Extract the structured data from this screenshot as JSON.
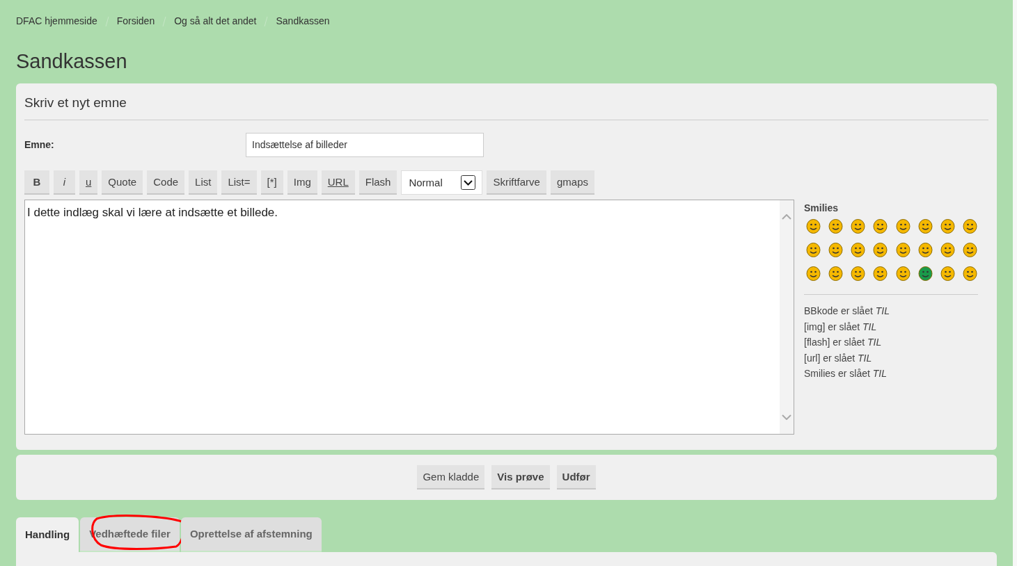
{
  "breadcrumbs": [
    "DFAC hjemmeside",
    "Forsiden",
    "Og så alt det andet",
    "Sandkassen"
  ],
  "page_title": "Sandkassen",
  "form": {
    "heading": "Skriv et nyt emne",
    "subject_label": "Emne:",
    "subject_value": "Indsættelse af billeder",
    "toolbar": [
      {
        "label": "B",
        "kind": "bold"
      },
      {
        "label": "i",
        "kind": "italic"
      },
      {
        "label": "u",
        "kind": "underline"
      },
      {
        "label": "Quote",
        "kind": "plain"
      },
      {
        "label": "Code",
        "kind": "plain"
      },
      {
        "label": "List",
        "kind": "plain"
      },
      {
        "label": "List=",
        "kind": "plain"
      },
      {
        "label": "[*]",
        "kind": "plain"
      },
      {
        "label": "Img",
        "kind": "plain"
      },
      {
        "label": "URL",
        "kind": "underline"
      },
      {
        "label": "Flash",
        "kind": "plain"
      },
      {
        "label": "Normal",
        "kind": "select"
      },
      {
        "label": "Skriftfarve",
        "kind": "plain"
      },
      {
        "label": "gmaps",
        "kind": "plain"
      }
    ],
    "message": "I dette indlæg skal vi lære at indsætte et billede.",
    "smilies_heading": "Smilies",
    "smilies": [
      {
        "color": "#f5b800"
      },
      {
        "color": "#f5b800"
      },
      {
        "color": "#f5b800"
      },
      {
        "color": "#f5b800"
      },
      {
        "color": "#f5b800"
      },
      {
        "color": "#f5b800"
      },
      {
        "color": "#f5b800"
      },
      {
        "color": "#f5b800"
      },
      {
        "color": "#f5b800"
      },
      {
        "color": "#f5b800"
      },
      {
        "color": "#f5b800"
      },
      {
        "color": "#f5b800"
      },
      {
        "color": "#f5b800"
      },
      {
        "color": "#f5b800"
      },
      {
        "color": "#f5b800"
      },
      {
        "color": "#f5b800"
      },
      {
        "color": "#f5b800"
      },
      {
        "color": "#f5b800"
      },
      {
        "color": "#f5b800"
      },
      {
        "color": "#f5b800"
      },
      {
        "color": "#f5b800"
      },
      {
        "color": "#1a9a4a"
      },
      {
        "color": "#f5b800"
      },
      {
        "color": "#f5b800"
      }
    ],
    "status_lines": [
      "BBkode er slået *TIL*",
      "[img] er slået *TIL*",
      "[flash] er slået *TIL*",
      "[url] er slået *TIL*",
      "Smilies er slået *TIL*"
    ]
  },
  "actions": [
    {
      "label": "Gem kladde",
      "primary": false
    },
    {
      "label": "Vis prøve",
      "primary": true
    },
    {
      "label": "Udfør",
      "primary": true
    }
  ],
  "tabs": [
    {
      "label": "Handling",
      "selected": true,
      "circled": false
    },
    {
      "label": "Vedhæftede filer",
      "selected": false,
      "circled": true
    },
    {
      "label": "Oprettelse af afstemning",
      "selected": false,
      "circled": false
    }
  ]
}
